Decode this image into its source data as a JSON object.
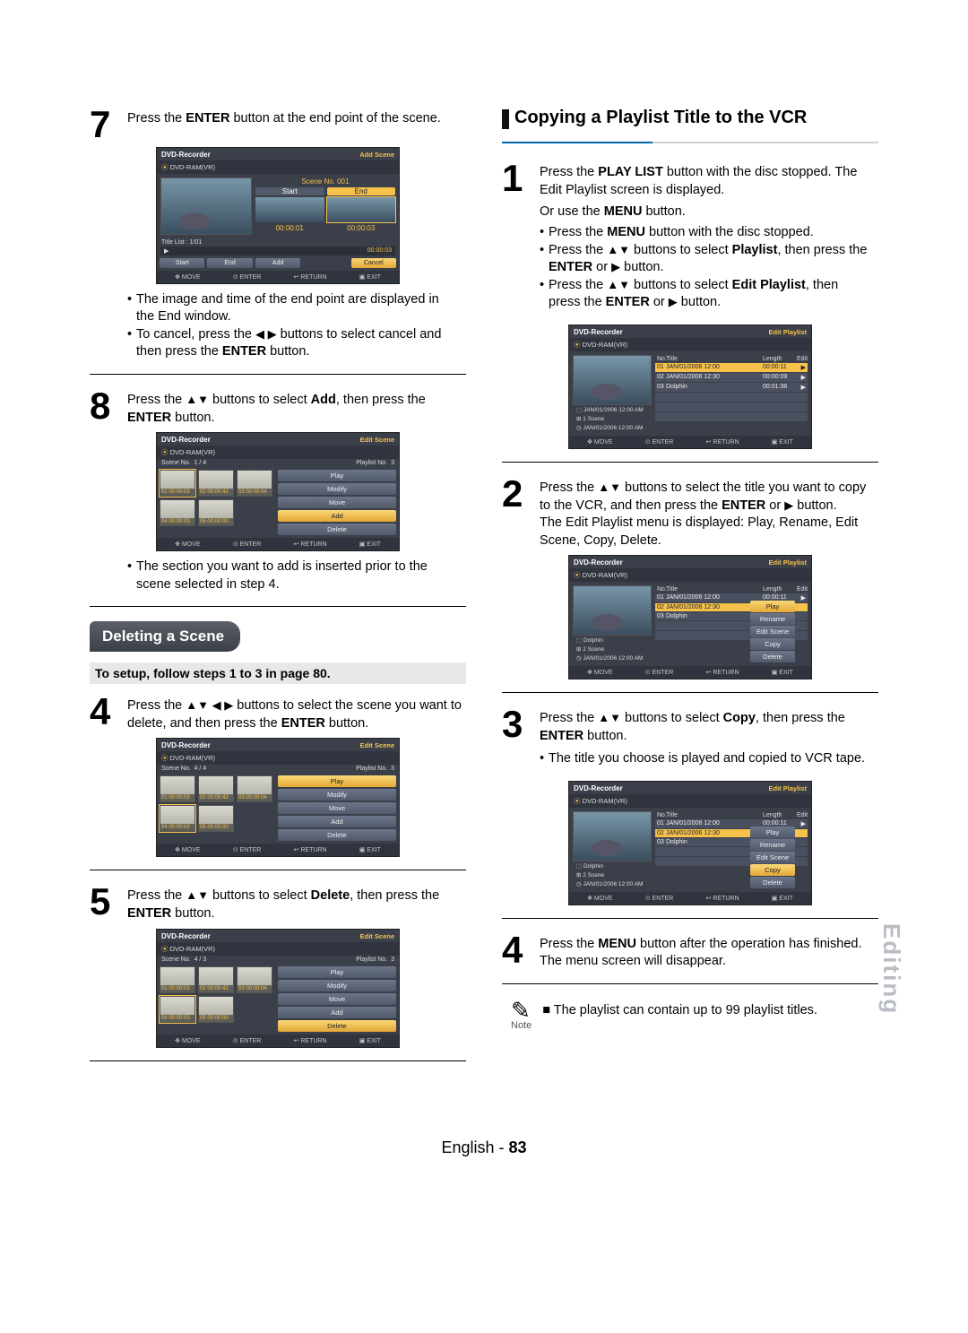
{
  "left": {
    "step7": {
      "num": "7",
      "text_a": "Press the ",
      "text_b": "ENTER",
      "text_c": " button at the end point of the scene."
    },
    "ui7": {
      "title": "DVD-Recorder",
      "mode": "Add Scene",
      "disc": "DVD-RAM(VR)",
      "sceneLabel": "Scene No. 001",
      "startLabel": "Start",
      "endLabel": "End",
      "titleList": "Title List : 1/01",
      "t1": "00:00:01",
      "t2": "00:00:03",
      "bar": "▶",
      "barTime": "00:00:03",
      "btnStart": "Start",
      "btnEnd": "End",
      "btnAdd": "Add",
      "btnCancel": "Cancel",
      "footMove": "MOVE",
      "footEnter": "ENTER",
      "footReturn": "RETURN",
      "footExit": "EXIT"
    },
    "bullets7": {
      "a": "The image and time of the end point are displayed in the End window.",
      "b_a": "To cancel, press the ",
      "b_arrows": "◀ ▶",
      "b_b": " buttons to select cancel and then press the ",
      "b_enter": "ENTER",
      "b_c": " button."
    },
    "step8": {
      "num": "8",
      "a": "Press the ",
      "arrows": "▲▼",
      "b": " buttons to select ",
      "add": "Add",
      "c": ", then press the ",
      "enter": "ENTER",
      "d": " button."
    },
    "ui8": {
      "title": "DVD-Recorder",
      "mode": "Edit Scene",
      "disc": "DVD-RAM(VR)",
      "sceneNoLabel": "Scene No.",
      "sceneNoVal": "1 / 4",
      "playlistNoLabel": "Playlist No.",
      "playlistNoVal": "3",
      "thumbs": [
        {
          "l": "01  00:00:03"
        },
        {
          "l": "02  00:00:42"
        },
        {
          "l": "03  00:00:04"
        },
        {
          "l": "04  00:00:03"
        },
        {
          "l": "05  00:00:00"
        }
      ],
      "side": [
        "Play",
        "Modify",
        "Move",
        "Add",
        "Delete"
      ],
      "hlIndex": 3
    },
    "bullets8": {
      "a": "The section you want to add is inserted prior to the scene selected in step 4."
    },
    "deleteHead": "Deleting a Scene",
    "setupNote": "To setup, follow steps 1 to 3 in page 80.",
    "step4": {
      "num": "4",
      "a": "Press the ",
      "arrows": "▲▼ ◀ ▶",
      "b": " buttons to select the scene you want to delete, and then press the ",
      "enter": "ENTER",
      "c": " button."
    },
    "ui4": {
      "title": "DVD-Recorder",
      "mode": "Edit Scene",
      "disc": "DVD-RAM(VR)",
      "sceneNoLabel": "Scene No.",
      "sceneNoVal": "4 / 4",
      "playlistNoLabel": "Playlist No.",
      "playlistNoVal": "3",
      "thumbs": [
        {
          "l": "01  00:00:03"
        },
        {
          "l": "02  00:00:42"
        },
        {
          "l": "03  00:00:04"
        },
        {
          "l": "04  00:00:03"
        },
        {
          "l": "05  00:00:00"
        }
      ],
      "side": [
        "Play",
        "Modify",
        "Move",
        "Add",
        "Delete"
      ],
      "hlIndex": 0
    },
    "step5": {
      "num": "5",
      "a": "Press the ",
      "arrows": "▲▼",
      "b": " buttons to select ",
      "del": "Delete",
      "c": ", then press the ",
      "enter": "ENTER",
      "d": " button."
    },
    "ui5": {
      "title": "DVD-Recorder",
      "mode": "Edit Scene",
      "disc": "DVD-RAM(VR)",
      "sceneNoLabel": "Scene No.",
      "sceneNoVal": "4 / 3",
      "playlistNoLabel": "Playlist No.",
      "playlistNoVal": "3",
      "thumbs": [
        {
          "l": "01  00:00:03"
        },
        {
          "l": "02  00:00:42"
        },
        {
          "l": "03  00:00:04"
        },
        {
          "l": "04  00:00:03"
        },
        {
          "l": "05  00:00:00"
        }
      ],
      "side": [
        "Play",
        "Modify",
        "Move",
        "Add",
        "Delete"
      ],
      "hlIndex": 4
    }
  },
  "right": {
    "sectionTitle": "Copying a Playlist Title to the VCR",
    "step1": {
      "num": "1",
      "a": "Press the ",
      "pl": "PLAY LIST",
      "b": " button with the disc stopped. The Edit Playlist screen is displayed."
    },
    "orMenu_a": "Or use the ",
    "orMenu_b": "MENU",
    "orMenu_c": " button.",
    "bullets1": {
      "a_a": "Press the ",
      "a_menu": "MENU",
      "a_b": " button with the disc stopped.",
      "b_a": "Press the ",
      "b_arrows": "▲▼",
      "b_b": " buttons to select ",
      "b_pl": "Playlist",
      "b_c": ", then press the ",
      "b_enter": "ENTER",
      "b_d": " or ",
      "b_play": "▶",
      "b_e": " button.",
      "c_a": "Press the ",
      "c_arrows": "▲▼",
      "c_b": " buttons to select ",
      "c_ep": "Edit Playlist",
      "c_c": ", then press the ",
      "c_enter": "ENTER",
      "c_d": " or ",
      "c_play": "▶",
      "c_e": " button."
    },
    "uiPL": {
      "title": "DVD-Recorder",
      "mode": "Edit Playlist",
      "disc": "DVD-RAM(VR)",
      "cols": {
        "no": "No.",
        "title": "Title",
        "len": "Length",
        "edit": "Edit"
      },
      "rows": [
        {
          "no": "01",
          "title": "JAN/01/2006 12:00",
          "len": "00:00:11",
          "edit": "▶"
        },
        {
          "no": "02",
          "title": "JAN/01/2006 12:30",
          "len": "00:00:09",
          "edit": "▶"
        },
        {
          "no": "03",
          "title": "Dolphin",
          "len": "00:01:36",
          "edit": "▶"
        }
      ],
      "meta": [
        "JAN/01/2006 12:00 AM",
        "1 Scene",
        "JAN/01/2006 12:00 AM"
      ],
      "footMove": "MOVE",
      "footEnter": "ENTER",
      "footReturn": "RETURN",
      "footExit": "EXIT"
    },
    "step2": {
      "num": "2",
      "a": "Press the ",
      "arrows": "▲▼",
      "b": " buttons to select the title you want to copy to the VCR, and then press the ",
      "enter": "ENTER",
      "c": " or ",
      "play": "▶",
      "d": " button.",
      "e": "The Edit Playlist menu is displayed: Play, Rename, Edit Scene, Copy, Delete."
    },
    "uiPL2": {
      "meta": [
        "Dolphin",
        "2 Scene",
        "JAN/01/2006 12:00 AM"
      ],
      "popup": [
        "Play",
        "Rename",
        "Edit Scene",
        "Copy",
        "Delete"
      ],
      "hlIndex": 0
    },
    "step3": {
      "num": "3",
      "a": "Press the ",
      "arrows": "▲▼",
      "b": " buttons to select ",
      "copy": "Copy",
      "c": ", then press the ",
      "enter": "ENTER",
      "d": " button."
    },
    "bullets3": {
      "a": "The title you choose is played and copied to VCR tape."
    },
    "uiPL3": {
      "meta": [
        "Dolphin",
        "2 Scene",
        "JAN/01/2006 12:00 AM"
      ],
      "popup": [
        "Play",
        "Rename",
        "Edit Scene",
        "Copy",
        "Delete"
      ],
      "hlIndex": 3
    },
    "step4": {
      "num": "4",
      "a": "Press the ",
      "menu": "MENU",
      "b": " button after the operation has finished. The menu screen will disappear."
    },
    "noteLabel": "Note",
    "noteText": "The playlist can contain up to 99 playlist titles."
  },
  "sidetab": "Editing",
  "footer_a": "English - ",
  "footer_b": "83",
  "footIcons": {
    "move": "✥ MOVE",
    "enter": "⊙ ENTER",
    "return": "↩ RETURN",
    "exit": "▣ EXIT"
  }
}
